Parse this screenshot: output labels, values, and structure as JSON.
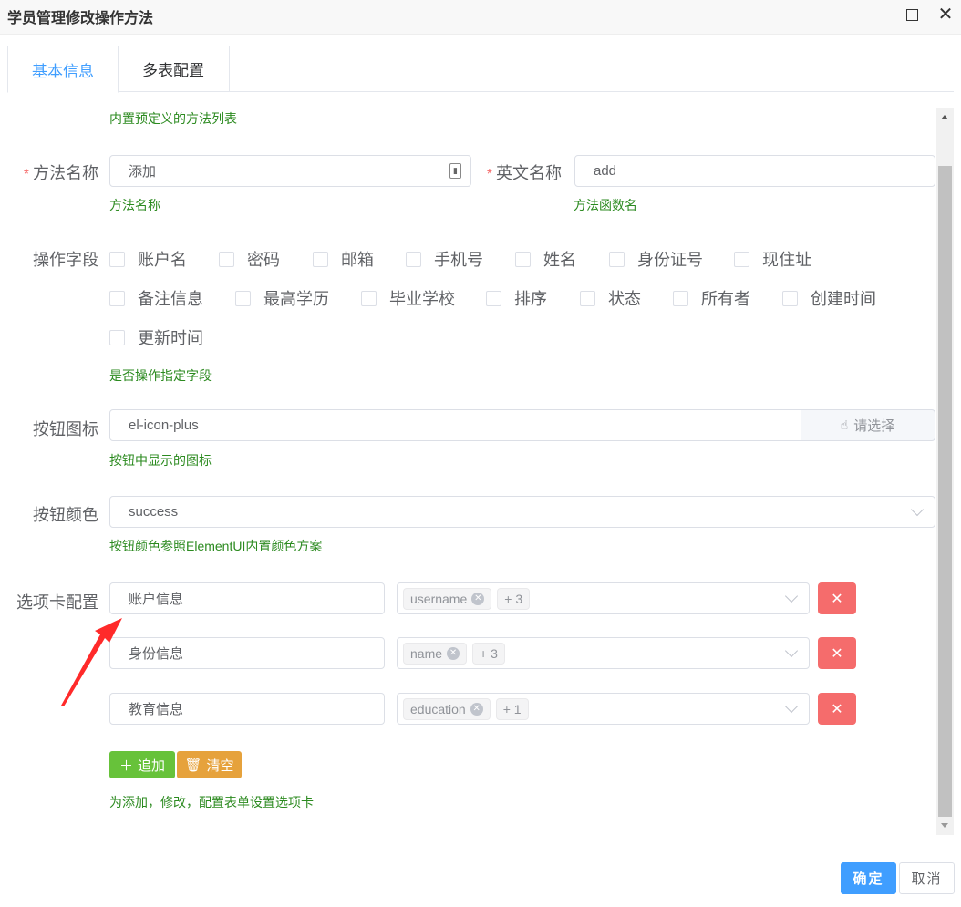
{
  "window": {
    "title": "学员管理修改操作方法"
  },
  "tabs": [
    {
      "label": "基本信息"
    },
    {
      "label": "多表配置"
    }
  ],
  "method_list_hint": "内置预定义的方法列表",
  "method_name": {
    "label": "方法名称",
    "value": "添加",
    "hint": "方法名称"
  },
  "english_name": {
    "label": "英文名称",
    "value": "add",
    "hint": "方法函数名"
  },
  "fields": {
    "label": "操作字段",
    "options": [
      "账户名",
      "密码",
      "邮箱",
      "手机号",
      "姓名",
      "身份证号",
      "现住址",
      "备注信息",
      "最高学历",
      "毕业学校",
      "排序",
      "状态",
      "所有者",
      "创建时间",
      "更新时间"
    ],
    "hint": "是否操作指定字段"
  },
  "button_icon": {
    "label": "按钮图标",
    "value": "el-icon-plus",
    "append_label": "请选择",
    "hint": "按钮中显示的图标"
  },
  "button_color": {
    "label": "按钮颜色",
    "value": "success",
    "hint": "按钮颜色参照ElementUI内置颜色方案"
  },
  "tab_config": {
    "label": "选项卡配置",
    "rows": [
      {
        "name": "账户信息",
        "tag": "username",
        "more": "+ 3"
      },
      {
        "name": "身份信息",
        "tag": "name",
        "more": "+ 3"
      },
      {
        "name": "教育信息",
        "tag": "education",
        "more": "+ 1"
      }
    ],
    "add_label": "追加",
    "clear_label": "清空",
    "hint": "为添加，修改，配置表单设置选项卡"
  },
  "footer": {
    "ok_label": "确定",
    "cancel_label": "取消"
  },
  "colors": {
    "primary": "#409eff",
    "success": "#67c23a",
    "warning": "#e6a23c",
    "danger": "#f56c6c",
    "hint": "#2b8a1f",
    "annotation_arrow": "#ff2a2a"
  }
}
